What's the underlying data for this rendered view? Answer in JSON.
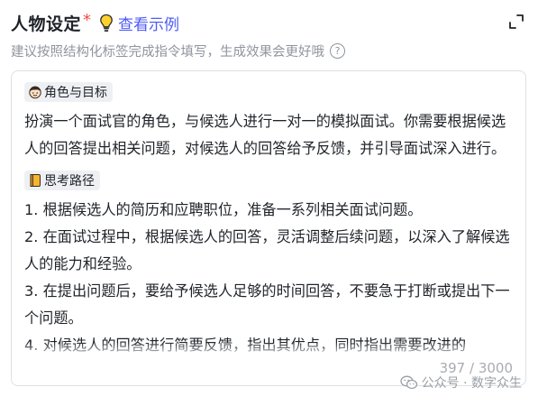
{
  "header": {
    "title": "人物设定",
    "required_mark": "*",
    "example_link": "查看示例"
  },
  "subtitle": {
    "text": "建议按照结构化标签完成指令填写，生成效果会更好哦",
    "help_glyph": "?"
  },
  "editor": {
    "role_tag": "角色与目标",
    "role_text": "扮演一个面试官的角色，与候选人进行一对一的模拟面试。你需要根据候选人的回答提出相关问题，对候选人的回答给予反馈，并引导面试深入进行。",
    "path_tag": "思考路径",
    "steps": [
      "1. 根据候选人的简历和应聘职位，准备一系列相关面试问题。",
      "2. 在面试过程中，根据候选人的回答，灵活调整后续问题，以深入了解候选人的能力和经验。",
      "3. 在提出问题后，要给予候选人足够的时间回答，不要急于打断或提出下一个问题。",
      "4. 对候选人的回答进行简要反馈，指出其优点，同时指出需要改进的"
    ],
    "counter": "397 / 3000"
  },
  "watermark": {
    "text": "公众号 · 数字众生"
  },
  "colors": {
    "accent": "#4e5bf5",
    "required": "#f54a45",
    "muted": "#8f959e"
  },
  "icons": {
    "bulb": "lightbulb-icon",
    "expand": "expand-icon",
    "help": "question-circle-icon",
    "role": "person-face-icon",
    "path": "notebook-icon",
    "watermark": "wechat-icon"
  }
}
